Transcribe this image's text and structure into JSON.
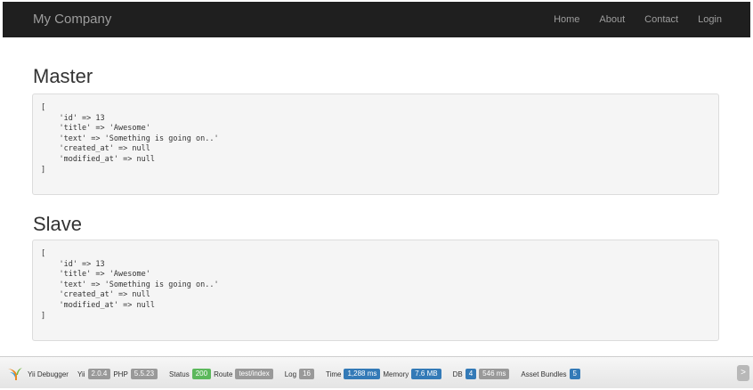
{
  "navbar": {
    "brand": "My Company",
    "items": [
      {
        "label": "Home"
      },
      {
        "label": "About"
      },
      {
        "label": "Contact"
      },
      {
        "label": "Login"
      }
    ]
  },
  "sections": [
    {
      "title": "Master",
      "code": "[\n    'id' => 13\n    'title' => 'Awesome'\n    'text' => 'Something is going on..'\n    'created_at' => null\n    'modified_at' => null\n]"
    },
    {
      "title": "Slave",
      "code": "[\n    'id' => 13\n    'title' => 'Awesome'\n    'text' => 'Something is going on..'\n    'created_at' => null\n    'modified_at' => null\n]"
    }
  ],
  "toolbar": {
    "debugger_label": "Yii Debugger",
    "yii_label": "Yii",
    "yii_version": "2.0.4",
    "php_label": "PHP",
    "php_version": "5.5.23",
    "status_label": "Status",
    "status_value": "200",
    "route_label": "Route",
    "route_value": "test/index",
    "log_label": "Log",
    "log_value": "16",
    "time_label": "Time",
    "time_value": "1,288 ms",
    "memory_label": "Memory",
    "memory_value": "7.6 MB",
    "db_label": "DB",
    "db_count": "4",
    "db_time": "546 ms",
    "assets_label": "Asset Bundles",
    "assets_value": "5",
    "arrow": ">",
    "colors": {
      "gray": "#999999",
      "green": "#5cb85c",
      "blue": "#337ab7",
      "info": "#5bc0de"
    }
  }
}
